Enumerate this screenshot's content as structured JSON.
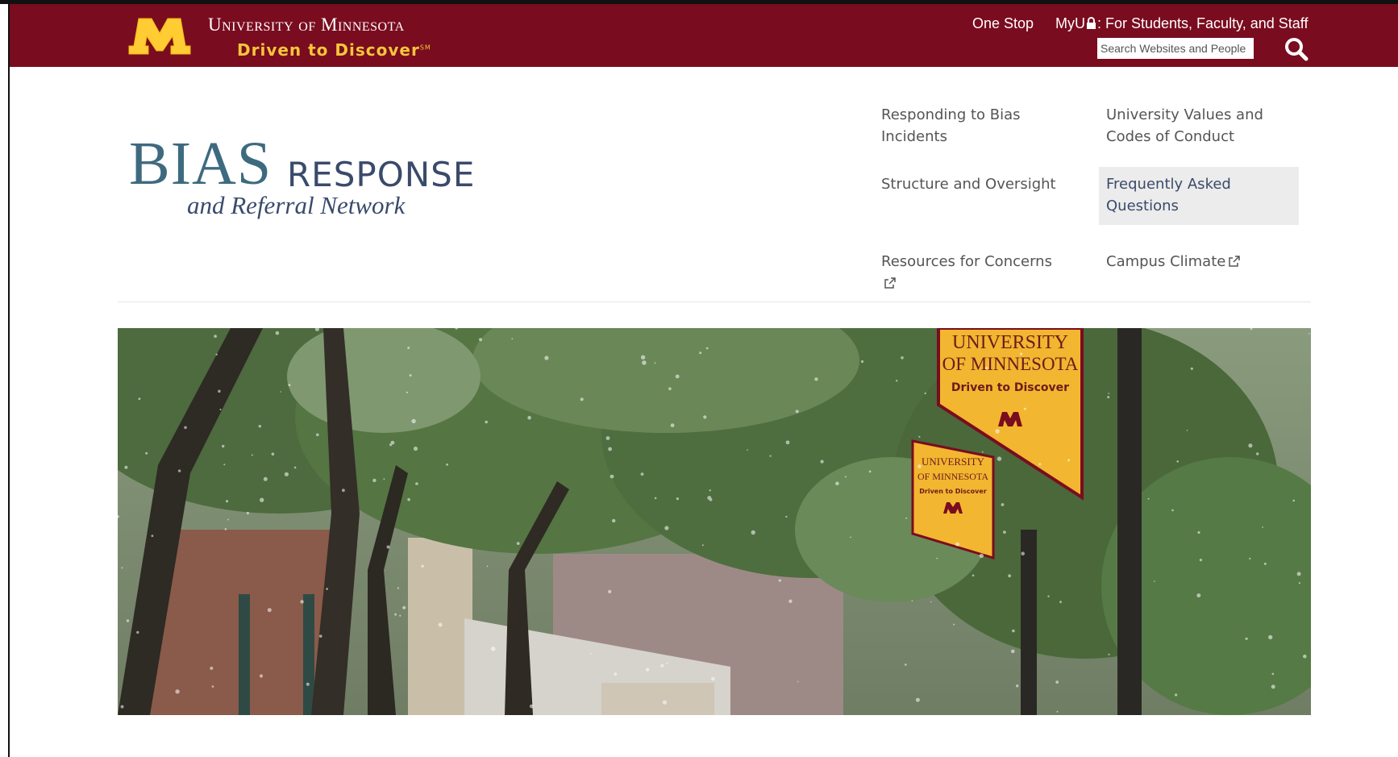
{
  "header": {
    "university_name": "University of Minnesota",
    "tagline": "Driven to Discover",
    "tagline_mark": "SM",
    "links": {
      "one_stop": "One Stop",
      "myu_prefix": "MyU",
      "myu_suffix": ": For Students, Faculty, and Staff"
    },
    "search": {
      "placeholder": "Search Websites and People"
    },
    "colors": {
      "maroon": "#7a0c1f",
      "gold": "#ffcc33"
    }
  },
  "site": {
    "logo": {
      "bias": "BIAS",
      "response": "RESPONSE",
      "subtitle": "and Referral Network"
    }
  },
  "nav": {
    "items": [
      {
        "label": "Responding to Bias Incidents",
        "external": false,
        "active": false
      },
      {
        "label": "University Values and Codes of Conduct",
        "external": false,
        "active": false
      },
      {
        "label": "Structure and Oversight",
        "external": false,
        "active": false
      },
      {
        "label": "Frequently Asked Questions",
        "external": false,
        "active": true
      },
      {
        "label": "Resources for Concerns",
        "external": true,
        "active": false
      },
      {
        "label": "Campus Climate",
        "external": true,
        "active": false
      }
    ]
  },
  "hero": {
    "banner_large": {
      "line1": "UNIVERSITY",
      "line2": "OF MINNESOTA",
      "line3": "Driven to Discover"
    },
    "banner_small": {
      "line1": "UNIVERSITY",
      "line2": "OF MINNESOTA",
      "line3": "Driven to Discover"
    }
  }
}
